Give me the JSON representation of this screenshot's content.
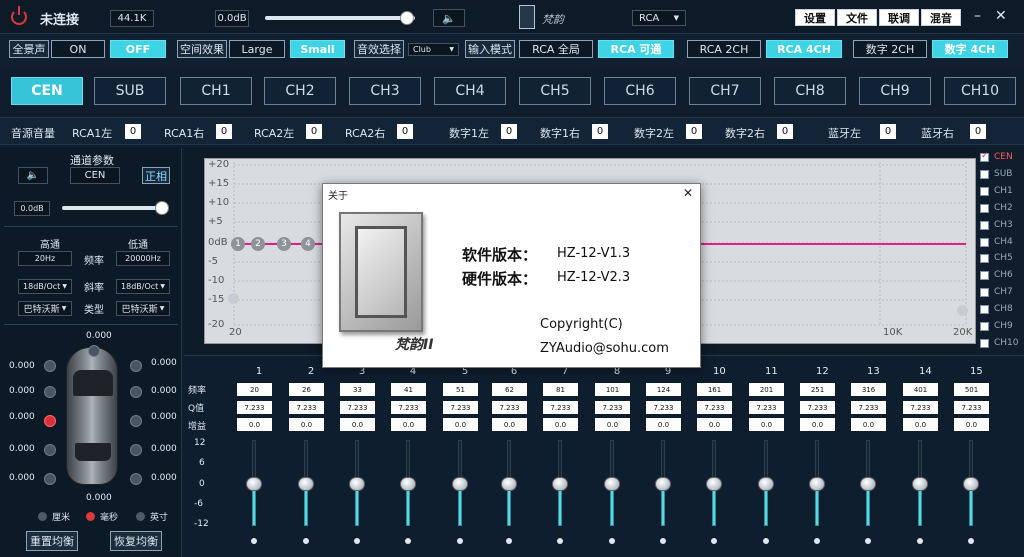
{
  "topbar": {
    "title": "未连接",
    "value_box": "44.1K",
    "master_db": "0.0dB",
    "logo_text": "梵韵",
    "rca_select": "RCA",
    "buttons": [
      "设置",
      "文件",
      "联调",
      "混音"
    ],
    "minimize": "–",
    "close": "✕"
  },
  "row2": {
    "all_sound_label": "全景声",
    "on": "ON",
    "off": "OFF",
    "space_label": "空间效果",
    "large": "Large",
    "small": "Small",
    "sound_select_label": "音效选择",
    "club": "Club",
    "input_mode_label": "输入模式",
    "rca_all": "RCA 全局",
    "rca_avail": "RCA 可通",
    "rca_2ch": "RCA 2CH",
    "rca_4ch": "RCA 4CH",
    "digital_2ch": "数字 2CH",
    "digital_4ch": "数字 4CH"
  },
  "tabs": [
    "CEN",
    "SUB",
    "CH1",
    "CH2",
    "CH3",
    "CH4",
    "CH5",
    "CH6",
    "CH7",
    "CH8",
    "CH9",
    "CH10"
  ],
  "source_gain": {
    "label": "音源音量",
    "items": [
      {
        "label": "RCA1左",
        "value": "0"
      },
      {
        "label": "RCA1右",
        "value": "0"
      },
      {
        "label": "RCA2左",
        "value": "0"
      },
      {
        "label": "RCA2右",
        "value": "0"
      },
      {
        "label": "数字1左",
        "value": "0"
      },
      {
        "label": "数字1右",
        "value": "0"
      },
      {
        "label": "数字2左",
        "value": "0"
      },
      {
        "label": "数字2右",
        "value": "0"
      },
      {
        "label": "蓝牙左",
        "value": "0"
      },
      {
        "label": "蓝牙右",
        "value": "0"
      }
    ]
  },
  "left_panel": {
    "channel_params": "通道参数",
    "channel": "CEN",
    "phase": "正相",
    "gain": "0.0dB",
    "hp": "高通",
    "lp": "低通",
    "freq": "频率",
    "slope": "斜率",
    "type": "类型",
    "hp_freq": "20Hz",
    "lp_freq": "20000Hz",
    "hp_slope": "18dB/Oct",
    "lp_slope": "18dB/Oct",
    "hp_type": "巴特沃斯",
    "lp_type": "巴特沃斯",
    "delay_values": {
      "top": "0.000",
      "l1": "0.000",
      "l2": "0.000",
      "l3": "0.000",
      "l4": "0.000",
      "l5": "0.000",
      "r1": "0.000",
      "r2": "0.000",
      "r3": "0.000",
      "r4": "0.000",
      "r5": "0.000",
      "bottom": "0.000"
    },
    "unit_cm": "厘米",
    "unit_ms": "毫秒",
    "unit_in": "英寸",
    "reset_eq": "重置均衡",
    "restore_eq": "恢复均衡"
  },
  "graph": {
    "y_labels": [
      "+20",
      "+15",
      "+10",
      "+5",
      "0dB",
      "-5",
      "-10",
      "-15",
      "-20"
    ],
    "x_labels": [
      "20",
      "10K",
      "20K"
    ],
    "markers": [
      "1",
      "2",
      "3",
      "4"
    ],
    "line_color": "#e0218a"
  },
  "channels_list": [
    {
      "name": "CEN",
      "checked": true
    },
    {
      "name": "SUB",
      "checked": false
    },
    {
      "name": "CH1",
      "checked": false
    },
    {
      "name": "CH2",
      "checked": false
    },
    {
      "name": "CH3",
      "checked": false
    },
    {
      "name": "CH4",
      "checked": false
    },
    {
      "name": "CH5",
      "checked": false
    },
    {
      "name": "CH6",
      "checked": false
    },
    {
      "name": "CH7",
      "checked": false
    },
    {
      "name": "CH8",
      "checked": false
    },
    {
      "name": "CH9",
      "checked": false
    },
    {
      "name": "CH10",
      "checked": false
    }
  ],
  "eq": {
    "row_labels": [
      "频率",
      "Q值",
      "增益"
    ],
    "scale": [
      "12",
      "6",
      "0",
      "-6",
      "-12"
    ],
    "bands": [
      {
        "n": "1",
        "f": "20",
        "q": "7.233",
        "g": "0.0"
      },
      {
        "n": "2",
        "f": "26",
        "q": "7.233",
        "g": "0.0"
      },
      {
        "n": "3",
        "f": "33",
        "q": "7.233",
        "g": "0.0"
      },
      {
        "n": "4",
        "f": "41",
        "q": "7.233",
        "g": "0.0"
      },
      {
        "n": "5",
        "f": "51",
        "q": "7.233",
        "g": "0.0"
      },
      {
        "n": "6",
        "f": "62",
        "q": "7.233",
        "g": "0.0"
      },
      {
        "n": "7",
        "f": "81",
        "q": "7.233",
        "g": "0.0"
      },
      {
        "n": "8",
        "f": "101",
        "q": "7.233",
        "g": "0.0"
      },
      {
        "n": "9",
        "f": "124",
        "q": "7.233",
        "g": "0.0"
      },
      {
        "n": "10",
        "f": "161",
        "q": "7.233",
        "g": "0.0"
      },
      {
        "n": "11",
        "f": "201",
        "q": "7.233",
        "g": "0.0"
      },
      {
        "n": "12",
        "f": "251",
        "q": "7.233",
        "g": "0.0"
      },
      {
        "n": "13",
        "f": "316",
        "q": "7.233",
        "g": "0.0"
      },
      {
        "n": "14",
        "f": "401",
        "q": "7.233",
        "g": "0.0"
      },
      {
        "n": "15",
        "f": "501",
        "q": "7.233",
        "g": "0.0"
      }
    ]
  },
  "dialog": {
    "title": "关于",
    "close": "✕",
    "sw_label": "软件版本：",
    "sw_value": "HZ-12-V1.3",
    "hw_label": "硬件版本：",
    "hw_value": "HZ-12-V2.3",
    "copyright": "Copyright(C)",
    "email": "ZYAudio@sohu.com",
    "logo_text": "梵韵II"
  }
}
